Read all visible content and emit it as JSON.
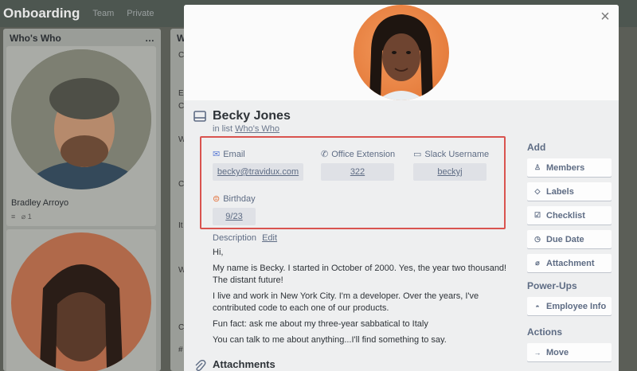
{
  "board": {
    "title": "Onboarding",
    "header_items": [
      "Team",
      "Private"
    ],
    "list1": {
      "title": "Who's Who",
      "menu_icon": "…",
      "card1": {
        "name": "Bradley Arroyo",
        "attachments": "1"
      }
    },
    "list2": {
      "title": "W",
      "snippets": [
        "C",
        "E",
        "C",
        "W",
        "C",
        "It",
        "W",
        "C",
        "#"
      ]
    }
  },
  "modal": {
    "close_icon": "×",
    "title": "Becky Jones",
    "in_list_prefix": "in list",
    "in_list_name": "Who's Who",
    "fields": {
      "email": {
        "label": "Email",
        "value": "becky@travidux.com"
      },
      "extension": {
        "label": "Office Extension",
        "value": "322"
      },
      "slack": {
        "label": "Slack Username",
        "value": "beckyj"
      },
      "birthday": {
        "label": "Birthday",
        "value": "9/23"
      }
    },
    "description": {
      "label": "Description",
      "edit_label": "Edit",
      "paragraphs": [
        "Hi,",
        "My name is Becky. I started in October of 2000. Yes, the year two thousand! The distant future!",
        "I live and work in New York City. I'm a developer. Over the years, I've contributed code to each one of our products.",
        "Fun fact: ask me about my three-year sabbatical to Italy",
        "You can talk to me about anything...I'll find something to say."
      ]
    },
    "attachments_title": "Attachments",
    "sidebar": {
      "add_heading": "Add",
      "add_buttons": [
        "Members",
        "Labels",
        "Checklist",
        "Due Date",
        "Attachment"
      ],
      "powerups_heading": "Power-Ups",
      "powerup_buttons": [
        "Employee Info"
      ],
      "actions_heading": "Actions",
      "action_buttons": [
        "Move"
      ]
    }
  },
  "colors": {
    "highlight_border": "#d9534f",
    "modal_bg": "#eeeff0",
    "button_bg": "#fdfdfd"
  }
}
